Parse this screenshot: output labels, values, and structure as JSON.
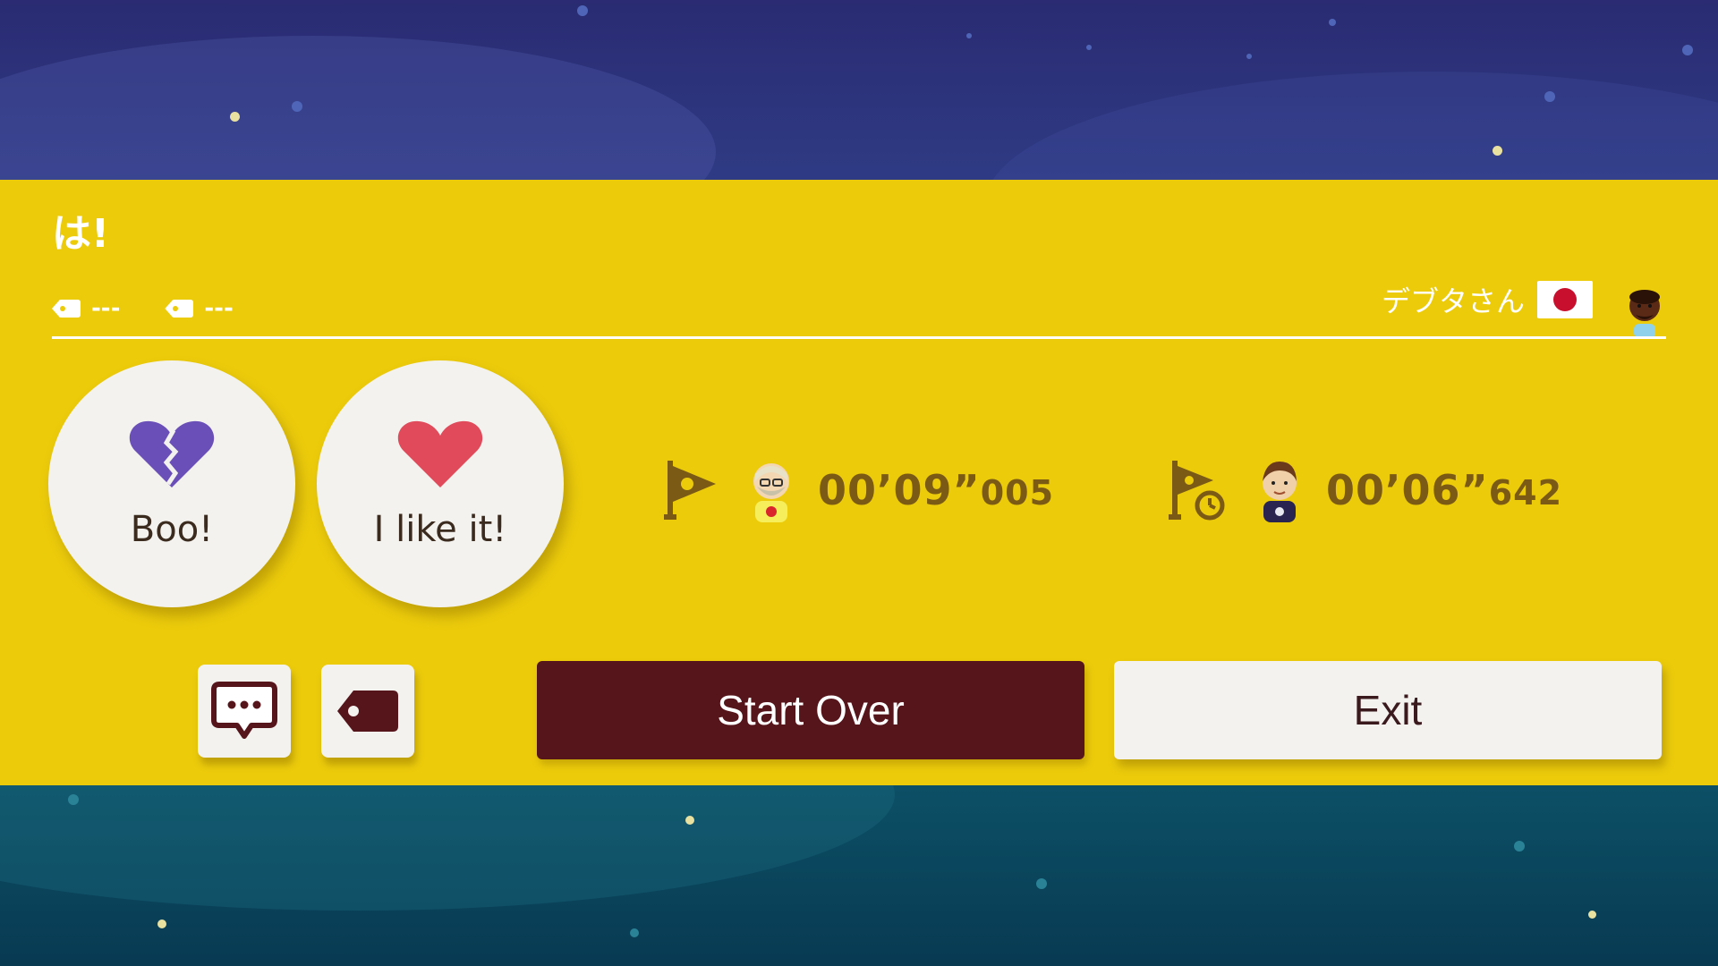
{
  "level": {
    "title": "は!",
    "tags": [
      "---",
      "---"
    ]
  },
  "creator": {
    "name": "デブタさん",
    "flag": "japan-flag-icon"
  },
  "reactions": {
    "boo_label": "Boo!",
    "like_label": "I like it!"
  },
  "stats": {
    "first_clear": {
      "icon": "first-clear-flag-icon",
      "time_main": "00’09”",
      "time_ms": "005"
    },
    "world_record": {
      "icon": "world-record-flag-icon",
      "time_main": "00’06”",
      "time_ms": "642"
    }
  },
  "actions": {
    "comment_icon": "comment-icon",
    "tag_icon": "tag-icon",
    "start_over_label": "Start Over",
    "exit_label": "Exit"
  },
  "colors": {
    "panel": "#eccb0b",
    "boo": "#6a4fb8",
    "like": "#e04a5a",
    "start_over": "#56141b",
    "time_text": "#7a5a14"
  }
}
